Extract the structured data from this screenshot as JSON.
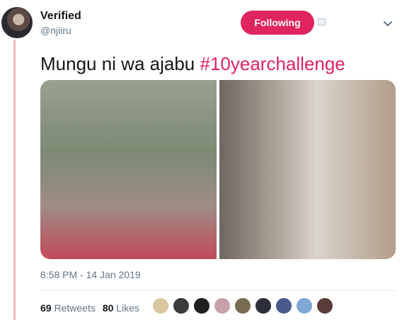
{
  "header": {
    "display_name": "Verified",
    "handle": "@njiiru",
    "follow_label": "Following"
  },
  "tweet": {
    "text": "Mungu ni wa ajabu ",
    "hashtag": "#10yearchallenge",
    "timestamp": "8:58 PM - 14 Jan 2019"
  },
  "stats": {
    "retweets_count": "69",
    "retweets_label": "Retweets",
    "likes_count": "80",
    "likes_label": "Likes"
  },
  "colors": {
    "accent": "#e0245e",
    "thread_line": "#f4b8bd",
    "muted_text": "#657786"
  },
  "likers": [
    {
      "color": "#d9c7a0"
    },
    {
      "color": "#3a3a3a"
    },
    {
      "color": "#1f1f1f"
    },
    {
      "color": "#c8a1a8"
    },
    {
      "color": "#7a6b55"
    },
    {
      "color": "#2c2f3a"
    },
    {
      "color": "#4b5a8c"
    },
    {
      "color": "#7fa8d6"
    },
    {
      "color": "#5a3b3a"
    }
  ]
}
